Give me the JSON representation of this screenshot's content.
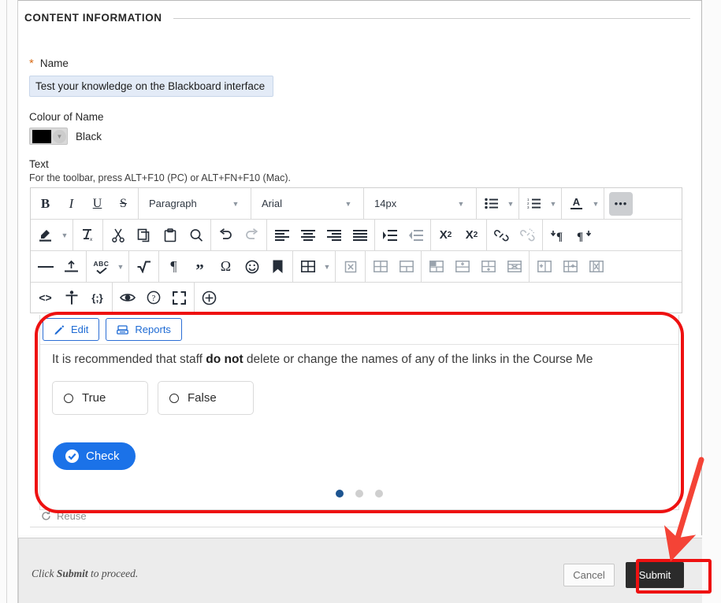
{
  "section": {
    "title": "CONTENT INFORMATION"
  },
  "name_field": {
    "label": "Name",
    "required_marker": "*",
    "value": "Test your knowledge on the Blackboard interface"
  },
  "colour_field": {
    "label": "Colour of Name",
    "value": "Black",
    "swatch_hex": "#000000"
  },
  "text_field": {
    "label": "Text",
    "hint": "For the toolbar, press ALT+F10 (PC) or ALT+FN+F10 (Mac)."
  },
  "toolbar": {
    "row1": {
      "bold": "B",
      "italic": "I",
      "underline": "U",
      "strikethrough": "S",
      "paragraph_select": "Paragraph",
      "font_select": "Arial",
      "size_select": "14px",
      "bullet_list": "bulleted-list-icon",
      "numbered_list": "numbered-list-icon",
      "text_colour": "A",
      "more": "•••"
    },
    "row2_icons": [
      "highlight-icon",
      "clear-formatting-icon",
      "cut-icon",
      "copy-icon",
      "paste-icon",
      "find-replace-icon",
      "undo-icon",
      "redo-icon",
      "align-left-icon",
      "align-center-icon",
      "align-right-icon",
      "align-justify-icon",
      "indent-increase-icon",
      "indent-decrease-icon",
      "superscript-icon",
      "subscript-icon",
      "insert-link-icon",
      "remove-link-icon",
      "ltr-icon",
      "rtl-icon"
    ],
    "row3_icons": [
      "horizontal-rule-icon",
      "page-break-icon",
      "spellcheck-icon",
      "math-formula-icon",
      "paragraph-mark-icon",
      "blockquote-icon",
      "special-character-icon",
      "emoticon-icon",
      "anchor-icon",
      "table-icon",
      "delete-table-icon",
      "table-row-props-icon",
      "table-cell-props-icon",
      "merge-cells-icon",
      "insert-row-above-icon",
      "insert-column-icon",
      "delete-row-icon",
      "insert-row-below-icon",
      "insert-column-after-icon",
      "delete-column-icon"
    ],
    "row4_icons": [
      "source-code-icon",
      "accessibility-checker-icon",
      "code-snippet-icon",
      "preview-icon",
      "help-icon",
      "fullscreen-icon",
      "add-content-icon"
    ],
    "superscript_label": "X",
    "superscript_sup": "2",
    "subscript_label": "X",
    "subscript_sub": "2",
    "spell_label": "ABC",
    "angle_label": "<>",
    "brace_label": "{;}"
  },
  "preview": {
    "tabs": [
      {
        "label": "Edit",
        "icon": "pencil-icon"
      },
      {
        "label": "Reports",
        "icon": "report-icon"
      }
    ],
    "question_prefix": "It is recommended that staff ",
    "question_bold": "do not",
    "question_suffix": " delete or change the names of any of the links in the Course Me",
    "choices": [
      {
        "label": "True"
      },
      {
        "label": "False"
      }
    ],
    "check_button": "Check",
    "check_icon": "check-circle-icon",
    "dots": {
      "total": 3,
      "active_index": 0
    }
  },
  "reuse": {
    "label": "Reuse",
    "icon": "reuse-icon"
  },
  "submit_bar": {
    "hint_prefix": "Click ",
    "hint_bold": "Submit",
    "hint_suffix": " to proceed.",
    "cancel_label": "Cancel",
    "submit_label": "Submit"
  },
  "annotations": {
    "highlight_colour": "#ee1111",
    "oval_target": "preview-area",
    "rect_target": "submit-button",
    "arrow_target": "submit-button"
  }
}
